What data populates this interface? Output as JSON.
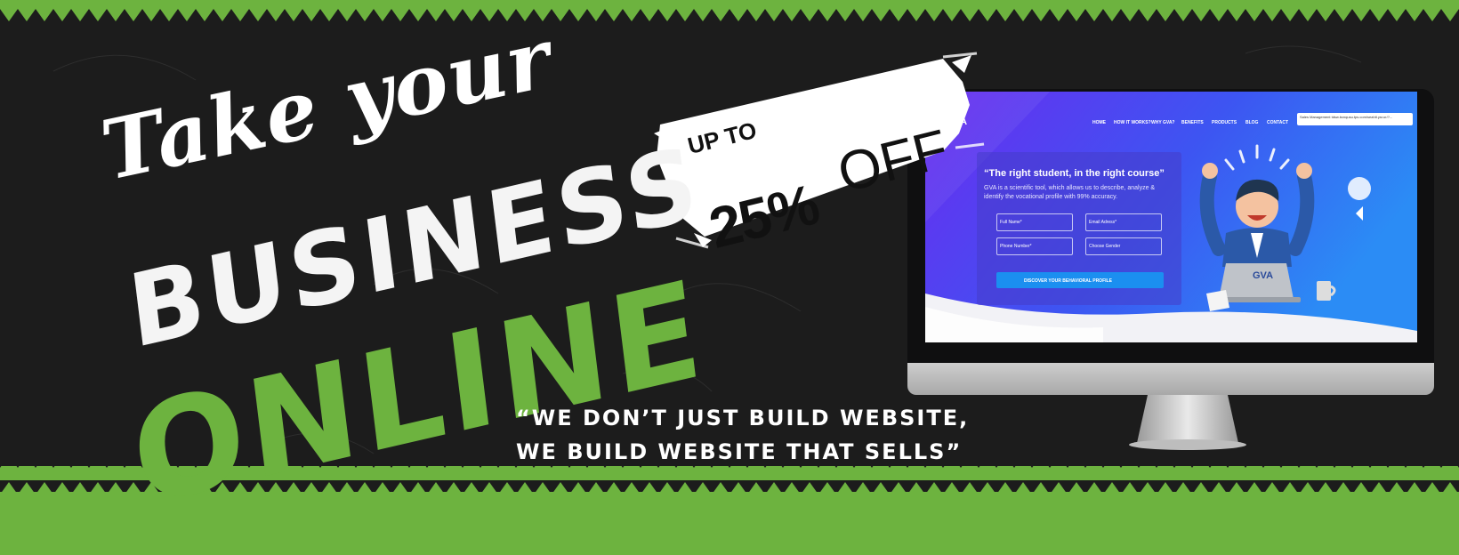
{
  "headline": {
    "script_line": "Take your",
    "line2": "BUSINESS",
    "line3": "ONLINE"
  },
  "promo": {
    "prefix": "UP TO",
    "percent": "25%",
    "suffix": "OFF"
  },
  "tagline": {
    "line1": "“WE DON’T JUST BUILD WEBSITE,",
    "line2": "WE BUILD WEBSITE THAT SELLS”"
  },
  "mockup": {
    "logo": "GVA",
    "nav": [
      "HOME",
      "HOW IT WORKS?",
      "WHY GVA?",
      "BENEFITS",
      "PRODUCTS",
      "BLOG",
      "CONTACT"
    ],
    "tooltip": "Sales Management  tdsw.bcnqusu.tps.com/seahlt.ysr.ur/?...",
    "card_title": "“The right student, in the right course”",
    "card_body": "GVA is a scientific tool, which allows us to describe, analyze & identify the vocational profile with 99% accuracy.",
    "fields": [
      "Full Name*",
      "Email Adress*",
      "Phone Number*",
      "Choose Gender"
    ],
    "cta": "DISCOVER YOUR BEHAVIORAL PROFILE",
    "laptop_logo": "GVA"
  },
  "colors": {
    "background": "#1c1c1c",
    "accent_green": "#6db33f",
    "screen_gradient_start": "#6a2cf0",
    "screen_gradient_end": "#2b8cf5"
  }
}
